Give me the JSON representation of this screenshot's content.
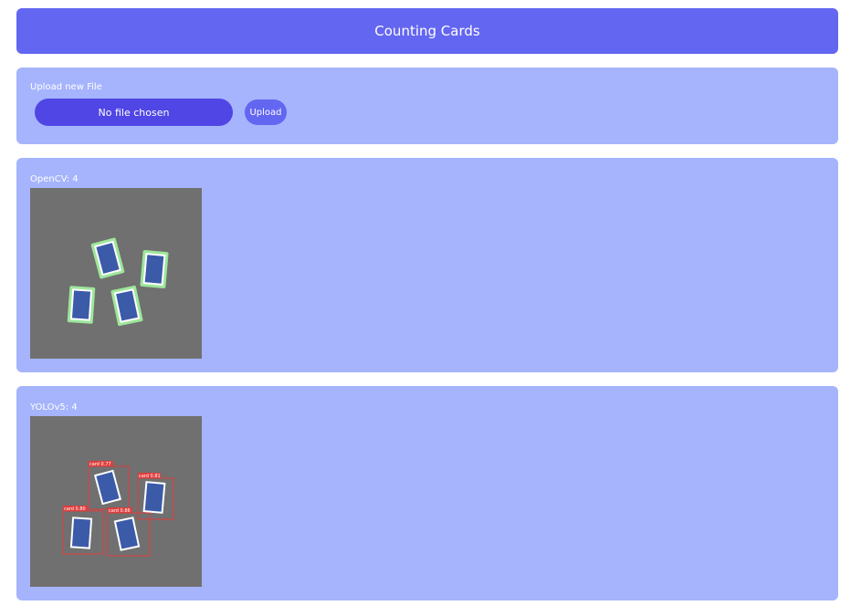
{
  "header": {
    "title": "Counting Cards"
  },
  "upload": {
    "label": "Upload new File",
    "file_input_text": "No file chosen",
    "button_label": "Upload"
  },
  "results": {
    "opencv": {
      "label": "OpenCV: 4"
    },
    "yolo": {
      "label": "YOLOv5: 4",
      "detections": [
        {
          "label": "card 0.77"
        },
        {
          "label": "card 0.81"
        },
        {
          "label": "card 0.80"
        },
        {
          "label": "card 0.86"
        }
      ]
    }
  },
  "colors": {
    "header_bg": "#6366f1",
    "panel_bg": "#a5b4fc",
    "file_input_bg": "#4f46e5",
    "card_blue": "#3b5aa8",
    "opencv_outline": "#9de69a",
    "yolo_box": "#e03c3c"
  }
}
